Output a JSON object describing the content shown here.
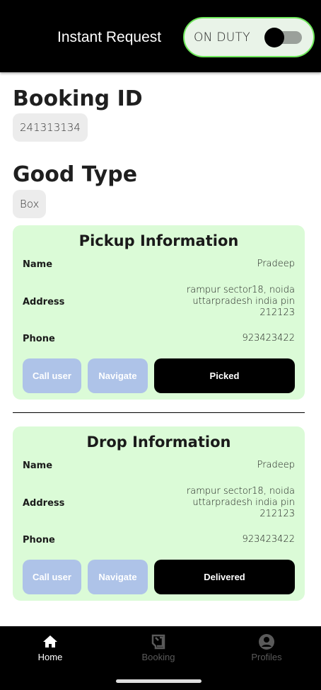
{
  "header": {
    "title": "Instant Request",
    "duty_label": "ON DUTY",
    "duty_on": false
  },
  "booking": {
    "label": "Booking ID",
    "value": "241313134"
  },
  "good": {
    "label": "Good Type",
    "value": "Box"
  },
  "pickup": {
    "title": "Pickup Information",
    "name_label": "Name",
    "name": "Pradeep",
    "address_label": "Address",
    "address": "rampur sector18, noida uttarpradesh india pin 212123",
    "phone_label": "Phone",
    "phone": "923423422",
    "call": "Call user",
    "navigate": "Navigate",
    "action": "Picked"
  },
  "drop": {
    "title": "Drop Information",
    "name_label": "Name",
    "name": "Pradeep",
    "address_label": "Address",
    "address": "rampur sector18, noida uttarpradesh india pin 212123",
    "phone_label": "Phone",
    "phone": "923423422",
    "call": "Call user",
    "navigate": "Navigate",
    "action": "Delivered"
  },
  "nav": {
    "items": [
      {
        "label": "Home",
        "icon": "home-icon",
        "active": true
      },
      {
        "label": "Booking",
        "icon": "booking-icon"
      },
      {
        "label": "Profiles",
        "icon": "profile-icon"
      }
    ]
  }
}
